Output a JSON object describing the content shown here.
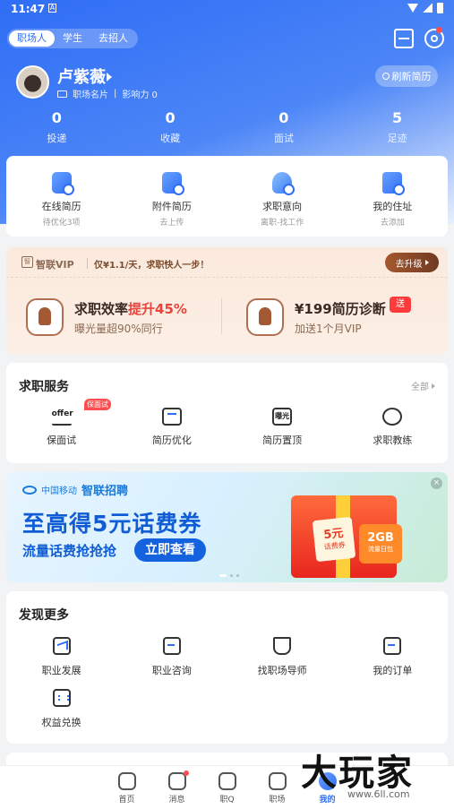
{
  "status_bar": {
    "time": "11:47",
    "notification_glyph": "A"
  },
  "role_tabs": [
    {
      "label": "职场人",
      "active": true
    },
    {
      "label": "学生",
      "active": false
    },
    {
      "label": "去招人",
      "active": false
    }
  ],
  "profile": {
    "name": "卢紫薇",
    "card_label": "职场名片",
    "influence": "影响力 0",
    "refresh_label": "刷新简历"
  },
  "stats": [
    {
      "value": "0",
      "label": "投递"
    },
    {
      "value": "0",
      "label": "收藏"
    },
    {
      "value": "0",
      "label": "面试"
    },
    {
      "value": "5",
      "label": "足迹"
    }
  ],
  "quick_actions": [
    {
      "label": "在线简历",
      "sub": "待优化3项",
      "icon": "resume-icon"
    },
    {
      "label": "附件简历",
      "sub": "去上传",
      "icon": "attachment-icon"
    },
    {
      "label": "求职意向",
      "sub": "离职-找工作",
      "icon": "heart-icon"
    },
    {
      "label": "我的住址",
      "sub": "去添加",
      "icon": "location-icon"
    }
  ],
  "vip": {
    "badge": "智",
    "brand": "智联VIP",
    "slogan": "仅¥1.1/天，求职快人一步！",
    "upgrade_label": "去升级",
    "features": [
      {
        "title_prefix": "求职效率",
        "title_highlight": "提升45%",
        "sub": "曝光量超90%同行"
      },
      {
        "title_prefix": "¥199简历诊断",
        "title_highlight": "",
        "sub": "加送1个月VIP"
      }
    ],
    "send_badge": "送"
  },
  "services": {
    "title": "求职服务",
    "more_label": "全部",
    "items": [
      {
        "label": "保面试",
        "icon_text": "offer",
        "badge": "保面试"
      },
      {
        "label": "简历优化",
        "icon_text": ""
      },
      {
        "label": "简历置顶",
        "icon_text": "曝光"
      },
      {
        "label": "求职教练",
        "icon_text": ""
      }
    ]
  },
  "banner": {
    "operator": "中国移动",
    "brand": "智联招聘",
    "title": "至高得5元话费券",
    "subtitle": "流量话费抢抢抢",
    "cta": "立即查看",
    "coupon_value": "5元",
    "coupon_label": "话费券",
    "data_value": "2GB",
    "data_label": "流量日包",
    "close": "×"
  },
  "discover": {
    "title": "发现更多",
    "items": [
      {
        "label": "职业发展",
        "icon": "growth-icon"
      },
      {
        "label": "职业咨询",
        "icon": "consult-icon"
      },
      {
        "label": "找职场导师",
        "icon": "mentor-cap-icon"
      },
      {
        "label": "我的订单",
        "icon": "order-icon"
      },
      {
        "label": "权益兑换",
        "icon": "rights-icon"
      }
    ]
  },
  "tabbar": [
    {
      "label": "首页",
      "active": false
    },
    {
      "label": "消息",
      "active": false,
      "dot": true
    },
    {
      "label": "职Q",
      "active": false
    },
    {
      "label": "职场",
      "active": false
    },
    {
      "label": "我的",
      "active": true
    }
  ],
  "watermark": {
    "text": "大玩家",
    "sub": "www.6ll.com"
  },
  "colors": {
    "brand_blue": "#2f6df5",
    "vip_brown": "#a5582f",
    "highlight_red": "#e8453c"
  }
}
